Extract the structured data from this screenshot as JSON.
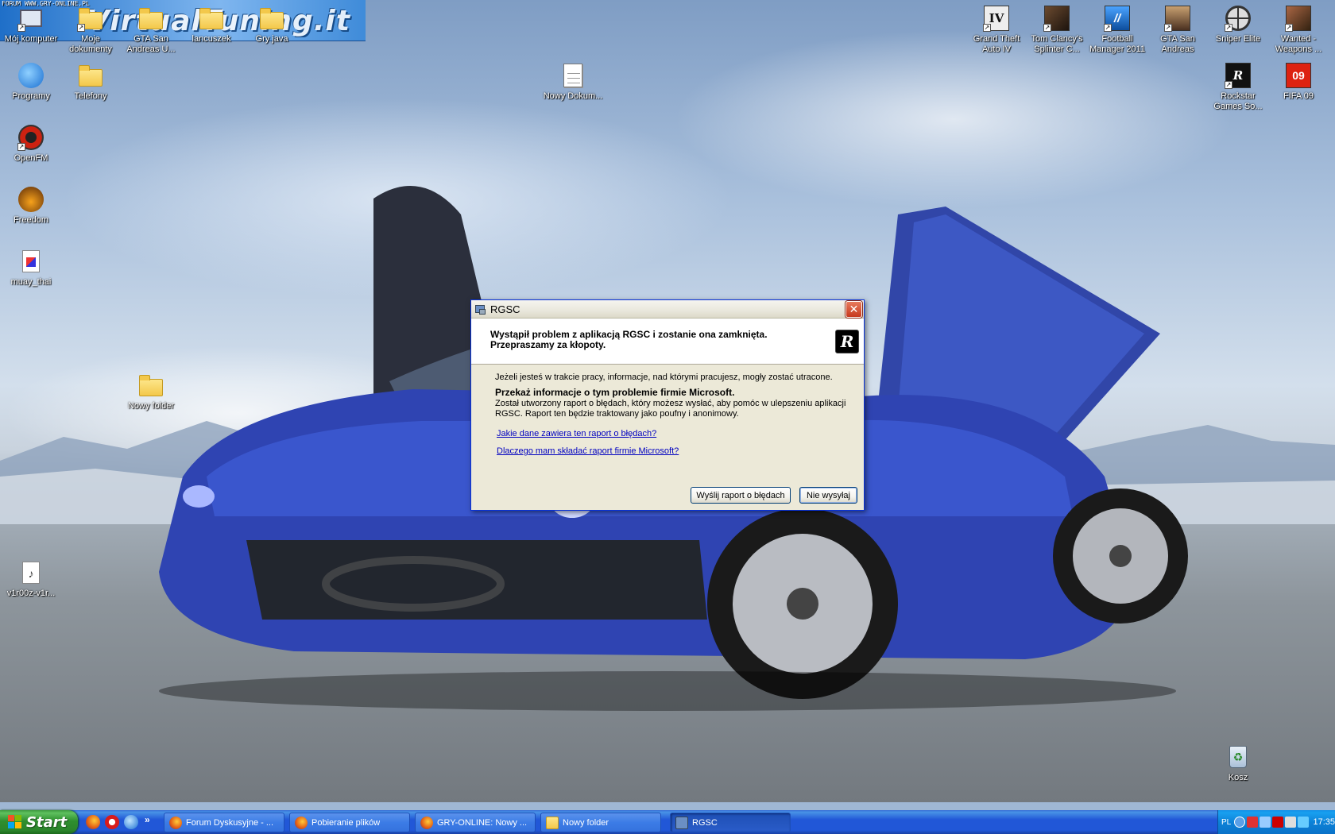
{
  "watermark": "FORUM WWW.GRY-ONLINE.PL",
  "banner_text": "VirtualTuning.it",
  "desktop_icons": [
    {
      "label": "Mój komputer"
    },
    {
      "label": "Moje dokumenty"
    },
    {
      "label": "GTA San Andreas U..."
    },
    {
      "label": "lancuszek"
    },
    {
      "label": "Gry java"
    },
    {
      "label": "Programy"
    },
    {
      "label": "Telefony"
    },
    {
      "label": "OpenFM"
    },
    {
      "label": "Freedom"
    },
    {
      "label": "muay_thai"
    },
    {
      "label": "Nowy folder"
    },
    {
      "label": "v1r00z-v1r..."
    },
    {
      "label": "Nowy Dokum..."
    },
    {
      "label": "Grand Theft Auto IV"
    },
    {
      "label": "Tom Clancy's Splinter C..."
    },
    {
      "label": "Football Manager 2011"
    },
    {
      "label": "GTA San Andreas"
    },
    {
      "label": "Sniper Elite"
    },
    {
      "label": "Wanted - Weapons ..."
    },
    {
      "label": "Rockstar Games So..."
    },
    {
      "label": "FIFA 09"
    },
    {
      "label": "Kosz"
    }
  ],
  "dialog": {
    "title": "RGSC",
    "close_glyph": "✕",
    "header": "Wystąpił problem z aplikacją RGSC i zostanie ona zamknięta. Przepraszamy za kłopoty.",
    "logo_glyph": "R",
    "line1": "Jeżeli jesteś w trakcie pracy, informacje, nad którymi pracujesz, mogły zostać utracone.",
    "bold_line": "Przekaż informacje o tym problemie firmie Microsoft.",
    "line2": "Został utworzony raport o błędach, który możesz wysłać, aby pomóc w ulepszeniu aplikacji RGSC. Raport ten będzie traktowany jako poufny i anonimowy.",
    "link1": "Jakie dane zawiera ten raport o błędach?",
    "link2": "Dlaczego mam składać raport firmie Microsoft?",
    "send_button": "Wyślij raport o błędach",
    "dont_send_button": "Nie wysyłaj"
  },
  "taskbar": {
    "start_label": "Start",
    "quicklaunch_more": "»",
    "tasks": [
      {
        "label": "Forum Dyskusyjne - ..."
      },
      {
        "label": "Pobieranie plików"
      },
      {
        "label": "GRY-ONLINE: Nowy ..."
      },
      {
        "label": "Nowy folder"
      },
      {
        "label": "RGSC"
      }
    ],
    "tray": {
      "language": "PL",
      "clock": "17:35"
    }
  },
  "colors": {
    "taskbar_blue": "#2157d7",
    "start_green": "#2f8f2f",
    "dialog_bg": "#ece9d8",
    "link_blue": "#0000c0"
  }
}
